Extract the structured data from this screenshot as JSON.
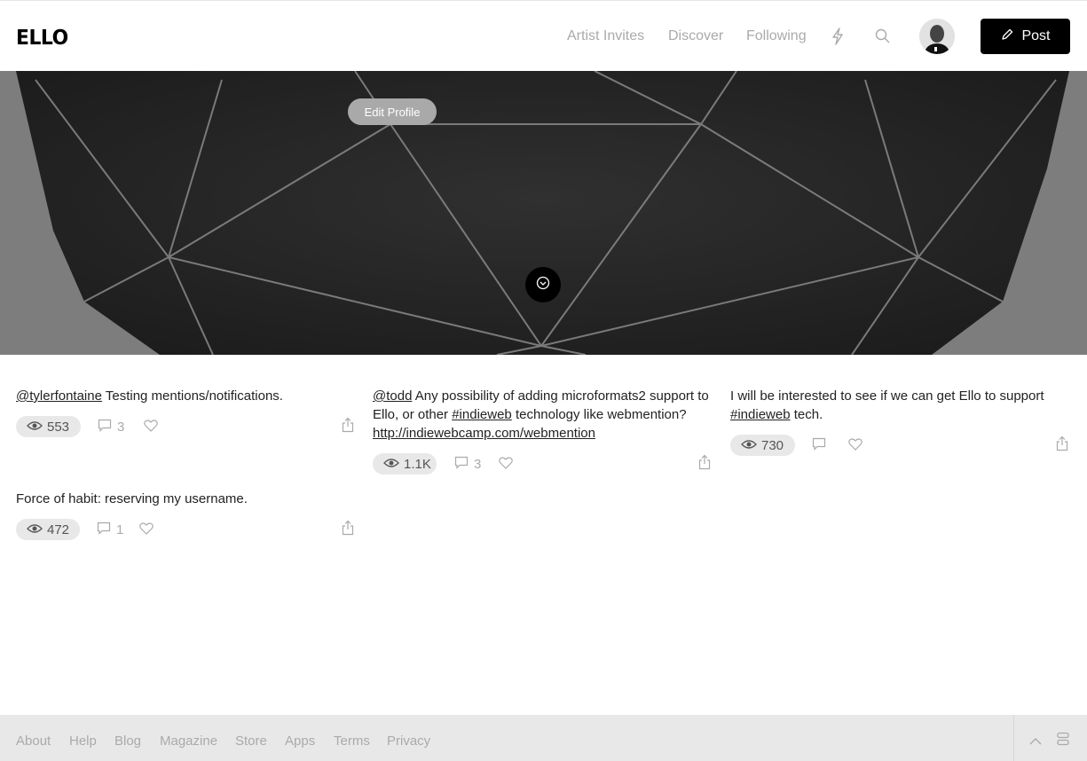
{
  "header": {
    "logo": "ELLO",
    "nav": [
      "Artist Invites",
      "Discover",
      "Following"
    ],
    "post_label": "Post",
    "icons": [
      "lightning-icon",
      "search-icon",
      "avatar",
      "pencil-icon"
    ]
  },
  "cover": {
    "edit_profile_label": "Edit Profile"
  },
  "posts": [
    {
      "mention": "@tylerfontaine",
      "text": " Testing mentions/notifications.",
      "views": "553",
      "comments": "3"
    },
    {
      "text": "Force of habit: reserving my username.",
      "views": "472",
      "comments": "1"
    },
    {
      "mention": "@todd",
      "text_a": " Any possibility of adding microformats2 support to Ello, or other ",
      "hashtag": "#indieweb",
      "text_b": " technology like webmention? ",
      "link": "http://indiewebcamp.com/webmention",
      "views": "1.1K",
      "comments": "3"
    },
    {
      "text_a": "I will be interested to see if we can get Ello to support ",
      "hashtag": "#indieweb",
      "text_b": " tech.",
      "views": "730",
      "comments": ""
    }
  ],
  "footer": {
    "links": [
      "About",
      "Help",
      "Blog",
      "Magazine",
      "Store",
      "Apps",
      "Terms",
      "Privacy"
    ]
  },
  "colors": {
    "accent": "#000000",
    "muted": "#aaaaaa",
    "footer_bg": "#e8e8e8"
  }
}
